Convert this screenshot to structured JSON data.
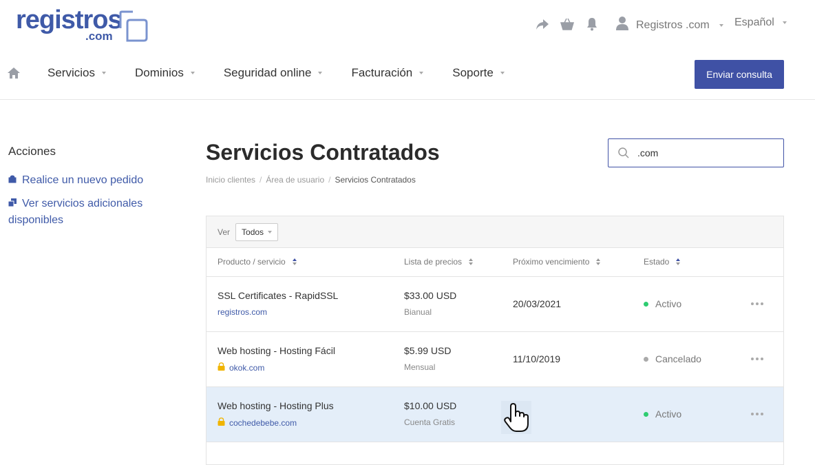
{
  "logo": {
    "main": "registros",
    "sub": ".com"
  },
  "header": {
    "account_label": "Registros .com",
    "language_label": "Español",
    "icons": [
      "share-icon",
      "basket-icon",
      "bell-icon",
      "user-icon"
    ]
  },
  "nav": {
    "items": [
      {
        "label": "Servicios"
      },
      {
        "label": "Dominios"
      },
      {
        "label": "Seguridad online"
      },
      {
        "label": "Facturación"
      },
      {
        "label": "Soporte"
      }
    ],
    "cta_label": "Enviar consulta"
  },
  "sidebar": {
    "title": "Acciones",
    "links": [
      {
        "label": "Realice un nuevo pedido",
        "icon": "bag-icon"
      },
      {
        "label": "Ver servicios adicionales disponibles",
        "icon": "addons-icon"
      }
    ]
  },
  "page": {
    "title": "Servicios Contratados",
    "breadcrumbs": [
      "Inicio clientes",
      "Área de usuario",
      "Servicios Contratados"
    ],
    "search_value": ".com"
  },
  "table": {
    "filter_label": "Ver",
    "filter_value": "Todos",
    "columns": [
      "Producto / servicio",
      "Lista de precios",
      "Próximo vencimiento",
      "Estado"
    ],
    "rows": [
      {
        "product": "SSL Certificates - RapidSSL",
        "domain": "registros.com",
        "locked": false,
        "price": "$33.00 USD",
        "cycle": "Bianual",
        "due": "20/03/2021",
        "status": "Activo",
        "status_color": "#2ecc71"
      },
      {
        "product": "Web hosting - Hosting Fácil",
        "domain": "okok.com",
        "locked": true,
        "price": "$5.99 USD",
        "cycle": "Mensual",
        "due": "11/10/2019",
        "status": "Cancelado",
        "status_color": "#aaaaaa"
      },
      {
        "product": "Web hosting - Hosting Plus",
        "domain": "cochedebebe.com",
        "locked": true,
        "price": "$10.00 USD",
        "cycle": "Cuenta Gratis",
        "due": "",
        "status": "Activo",
        "status_color": "#2ecc71"
      }
    ]
  },
  "colors": {
    "brand": "#3f5aa8",
    "primary_button": "#3f51a5",
    "row_highlight": "#e4eef9"
  }
}
